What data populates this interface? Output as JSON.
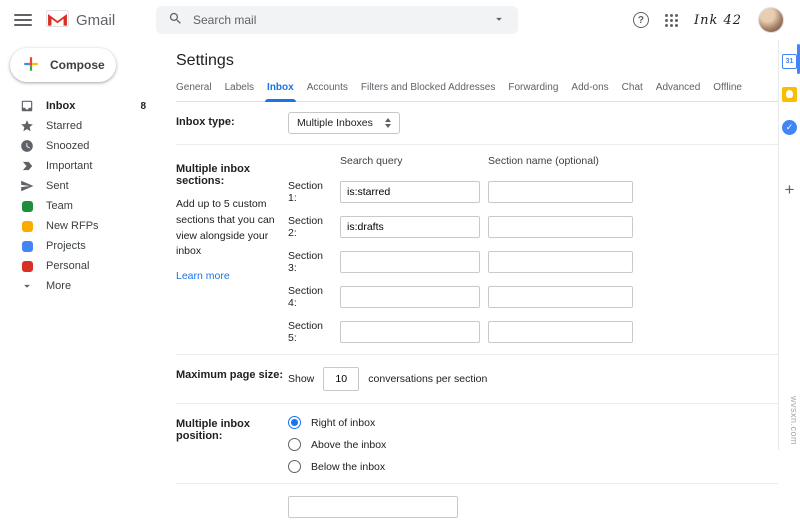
{
  "colors": {
    "accent": "#1a73e8",
    "link": "#1a73e8"
  },
  "header": {
    "brand": "Gmail",
    "search_placeholder": "Search mail",
    "account_logo": "Ink 42"
  },
  "sidebar": {
    "compose_label": "Compose",
    "items": [
      {
        "label": "Inbox",
        "icon": "inbox",
        "count": "8"
      },
      {
        "label": "Starred",
        "icon": "star"
      },
      {
        "label": "Snoozed",
        "icon": "clock"
      },
      {
        "label": "Important",
        "icon": "important"
      },
      {
        "label": "Sent",
        "icon": "send"
      },
      {
        "label": "Team",
        "icon": "label",
        "color": "#1e8e3e"
      },
      {
        "label": "New RFPs",
        "icon": "label",
        "color": "#f9ab00"
      },
      {
        "label": "Projects",
        "icon": "label",
        "color": "#4285f4"
      },
      {
        "label": "Personal",
        "icon": "label",
        "color": "#d93025"
      },
      {
        "label": "More",
        "icon": "chevron-down"
      }
    ]
  },
  "settings": {
    "title": "Settings",
    "tabs": [
      {
        "label": "General"
      },
      {
        "label": "Labels"
      },
      {
        "label": "Inbox",
        "active": true
      },
      {
        "label": "Accounts"
      },
      {
        "label": "Filters and Blocked Addresses"
      },
      {
        "label": "Forwarding"
      },
      {
        "label": "Add-ons"
      },
      {
        "label": "Chat"
      },
      {
        "label": "Advanced"
      },
      {
        "label": "Offline"
      }
    ],
    "inbox_type": {
      "label": "Inbox type:",
      "value": "Multiple Inboxes"
    },
    "sections": {
      "label": "Multiple inbox sections:",
      "description": "Add up to 5 custom sections that you can view alongside your inbox",
      "learn_more": "Learn more",
      "col_query": "Search query",
      "col_name": "Section name (optional)",
      "rows": [
        {
          "label": "Section 1:",
          "query": "is:starred",
          "name": ""
        },
        {
          "label": "Section 2:",
          "query": "is:drafts",
          "name": ""
        },
        {
          "label": "Section 3:",
          "query": "",
          "name": ""
        },
        {
          "label": "Section 4:",
          "query": "",
          "name": ""
        },
        {
          "label": "Section 5:",
          "query": "",
          "name": ""
        }
      ]
    },
    "page_size": {
      "label": "Maximum page size:",
      "prefix": "Show",
      "value": "10",
      "suffix": "conversations per section"
    },
    "position": {
      "label": "Multiple inbox position:",
      "options": [
        {
          "label": "Right of inbox",
          "selected": true
        },
        {
          "label": "Above the inbox"
        },
        {
          "label": "Below the inbox"
        }
      ]
    }
  },
  "right_rail": {
    "icons": [
      "calendar",
      "keep",
      "tasks",
      "add"
    ],
    "calendar_day": "31"
  },
  "watermark": "wvsxn.com"
}
